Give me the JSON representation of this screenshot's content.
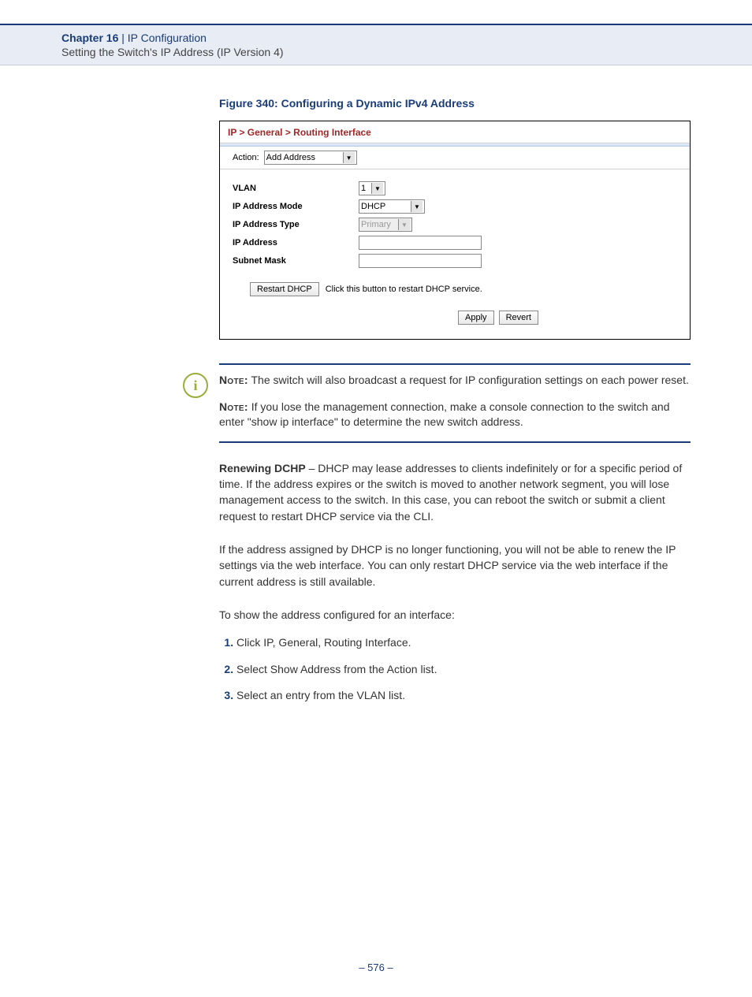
{
  "header": {
    "chapter": "Chapter 16",
    "divider": "  |  ",
    "title": "IP Configuration",
    "subtitle": "Setting the Switch's IP Address (IP Version 4)"
  },
  "figure": {
    "caption": "Figure 340:  Configuring a Dynamic IPv4 Address",
    "breadcrumb": "IP > General > Routing Interface",
    "action_label": "Action:",
    "action_value": "Add Address",
    "rows": {
      "vlan": {
        "label": "VLAN",
        "value": "1"
      },
      "mode": {
        "label": "IP Address Mode",
        "value": "DHCP"
      },
      "type": {
        "label": "IP Address Type",
        "value": "Primary"
      },
      "addr": {
        "label": "IP Address",
        "value": ""
      },
      "mask": {
        "label": "Subnet Mask",
        "value": ""
      }
    },
    "restart_btn": "Restart DHCP",
    "restart_hint": "Click this button to restart DHCP service.",
    "apply": "Apply",
    "revert": "Revert"
  },
  "notes": {
    "label": "Note:",
    "n1": " The switch will also broadcast a request for IP configuration settings on each power reset.",
    "n2": " If you lose the management connection, make a console connection to the switch and enter \"show ip interface\" to determine the new switch address."
  },
  "body": {
    "renew_title": "Renewing DCHP",
    "renew_text": " – DHCP may lease addresses to clients indefinitely or for a specific period of time. If the address expires or the switch is moved to another network segment, you will lose management access to the switch. In this case, you can reboot the switch or submit a client request to restart DHCP service via the CLI.",
    "p2": "If the address assigned by DHCP is no longer functioning, you will not be able to renew the IP settings via the web interface. You can only restart DHCP service via the web interface if the current address is still available.",
    "p3": "To show the address configured for an interface:",
    "steps": [
      "Click IP, General, Routing Interface.",
      "Select Show Address from the Action list.",
      "Select an entry from the VLAN list."
    ]
  },
  "page_num": "– 576 –"
}
